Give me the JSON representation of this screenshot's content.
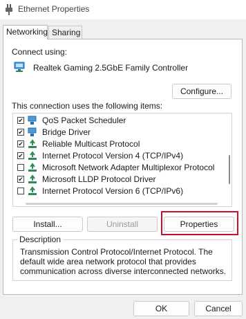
{
  "window": {
    "title": "Ethernet Properties",
    "icon": "ethernet-plug-icon"
  },
  "tabs": [
    {
      "label": "Networking",
      "active": true
    },
    {
      "label": "Sharing",
      "active": false
    }
  ],
  "connect_using": {
    "label": "Connect using:",
    "adapter_name": "Realtek Gaming 2.5GbE Family Controller",
    "adapter_icon": "network-adapter-icon",
    "configure_label": "Configure..."
  },
  "items_section": {
    "label": "This connection uses the following items:",
    "items": [
      {
        "label": "QoS Packet Scheduler",
        "checked": true,
        "icon": "network-service-icon"
      },
      {
        "label": "Bridge Driver",
        "checked": true,
        "icon": "network-service-icon"
      },
      {
        "label": "Reliable Multicast Protocol",
        "checked": true,
        "icon": "protocol-icon"
      },
      {
        "label": "Internet Protocol Version 4 (TCP/IPv4)",
        "checked": true,
        "icon": "protocol-icon"
      },
      {
        "label": "Microsoft Network Adapter Multiplexor Protocol",
        "checked": false,
        "icon": "protocol-icon"
      },
      {
        "label": "Microsoft LLDP Protocol Driver",
        "checked": true,
        "icon": "protocol-icon"
      },
      {
        "label": "Internet Protocol Version 6 (TCP/IPv6)",
        "checked": false,
        "icon": "protocol-icon"
      }
    ]
  },
  "buttons": {
    "install": "Install...",
    "uninstall": "Uninstall",
    "properties": "Properties"
  },
  "description": {
    "legend": "Description",
    "text": "Transmission Control Protocol/Internet Protocol. The default wide area network protocol that provides communication across diverse interconnected networks."
  },
  "footer": {
    "ok": "OK",
    "cancel": "Cancel"
  },
  "colors": {
    "highlight_border": "#c8102e",
    "protocol_green": "#2e8b57",
    "adapter_blue": "#1f6fb2"
  }
}
